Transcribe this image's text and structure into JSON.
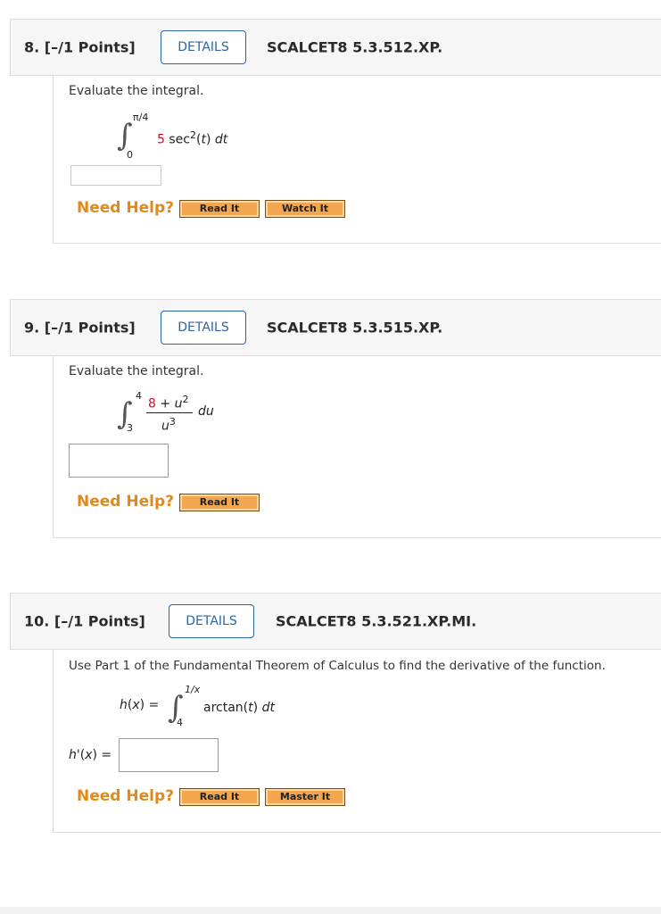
{
  "questions": [
    {
      "title": "8. [–/1 Points]",
      "details_label": "DETAILS",
      "code": "SCALCET8 5.3.512.XP.",
      "prompt": "Evaluate the integral.",
      "upper_limit": "π/4",
      "lower_limit": "0",
      "integrand_coef": "5",
      "integrand_func": "sec",
      "integrand_exp": "2",
      "integrand_arg": "(t)",
      "integrand_d": "dt",
      "answer_value": "",
      "need_help": "Need Help?",
      "help_buttons": [
        "Read It",
        "Watch It"
      ]
    },
    {
      "title": "9. [–/1 Points]",
      "details_label": "DETAILS",
      "code": "SCALCET8 5.3.515.XP.",
      "prompt": "Evaluate the integral.",
      "upper_limit": "4",
      "lower_limit": "3",
      "numerator_const": "8",
      "numerator_plus": " + ",
      "numerator_var": "u",
      "numerator_exp": "2",
      "denominator_var": "u",
      "denominator_exp": "3",
      "integrand_d": "du",
      "answer_value": "",
      "need_help": "Need Help?",
      "help_buttons": [
        "Read It"
      ]
    },
    {
      "title": "10. [–/1 Points]",
      "details_label": "DETAILS",
      "code": "SCALCET8 5.3.521.XP.MI.",
      "prompt": "Use Part 1 of the Fundamental Theorem of Calculus to find the derivative of the function.",
      "function_lhs": "h(x) =",
      "upper_limit": "1/x",
      "lower_limit": "4",
      "integrand_func": "arctan",
      "integrand_arg": "(t)",
      "integrand_d": "dt",
      "answer_label": "h'(x) =",
      "answer_value": "",
      "need_help": "Need Help?",
      "help_buttons": [
        "Read It",
        "Master It"
      ]
    }
  ]
}
